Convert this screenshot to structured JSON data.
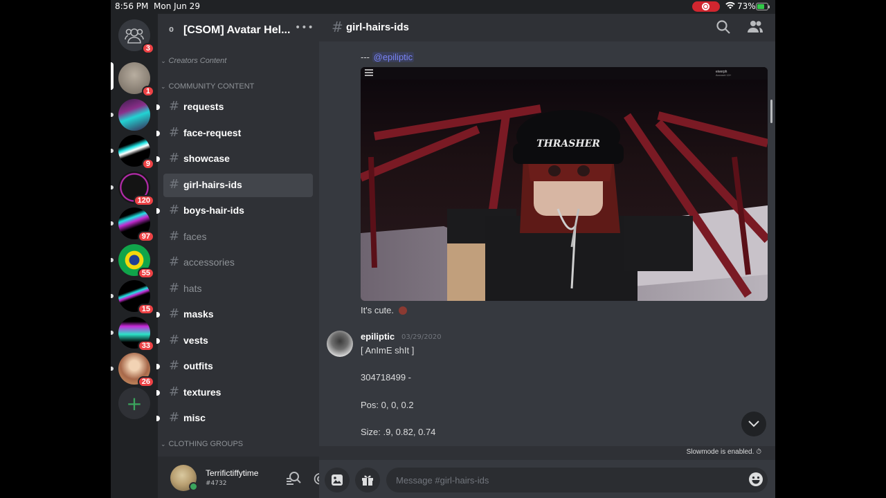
{
  "status_bar": {
    "time": "8:56 PM",
    "date": "Mon Jun 29",
    "battery_percent": "73%",
    "battery_level": 0.73,
    "recording": true,
    "colors": {
      "record": "#d0262f",
      "battery": "#33c84a"
    }
  },
  "servers": {
    "dm_badge": "3",
    "items": [
      {
        "name": "server-1",
        "badge": "1",
        "selected": true
      },
      {
        "name": "server-2",
        "badge": ""
      },
      {
        "name": "server-3",
        "badge": "9"
      },
      {
        "name": "server-4",
        "badge": "120"
      },
      {
        "name": "server-5",
        "badge": "97"
      },
      {
        "name": "server-6",
        "badge": "55"
      },
      {
        "name": "server-7",
        "badge": "15"
      },
      {
        "name": "server-8",
        "badge": "33"
      },
      {
        "name": "server-9",
        "badge": "26"
      }
    ],
    "add_label": "+"
  },
  "server_header": {
    "boost_count": "0",
    "name": "[CSOM] Avatar Hel...",
    "more_label": "•••"
  },
  "categories": {
    "creators": "Creators Content",
    "community": "COMMUNITY CONTENT",
    "clothing": "CLOTHING GROUPS"
  },
  "channels": [
    {
      "name": "requests",
      "state": "unread"
    },
    {
      "name": "face-request",
      "state": "unread"
    },
    {
      "name": "showcase",
      "state": "unread"
    },
    {
      "name": "girl-hairs-ids",
      "state": "active"
    },
    {
      "name": "boys-hair-ids",
      "state": "unread"
    },
    {
      "name": "faces",
      "state": "read"
    },
    {
      "name": "accessories",
      "state": "read"
    },
    {
      "name": "hats",
      "state": "read"
    },
    {
      "name": "masks",
      "state": "unread"
    },
    {
      "name": "vests",
      "state": "unread"
    },
    {
      "name": "outfits",
      "state": "unread"
    },
    {
      "name": "textures",
      "state": "unread"
    },
    {
      "name": "misc",
      "state": "unread"
    }
  ],
  "user": {
    "name": "Terrifictiffytime",
    "discriminator": "#4732",
    "status": "online"
  },
  "chat": {
    "channel_title": "girl-hairs-ids",
    "messages": {
      "prefix": "---",
      "mention": "@epiliptic",
      "embed_overlay_name": "eiverph",
      "embed_overlay_sub": "Account 13+",
      "embed_brand_text": "THRASHER",
      "caption": "It's cute.",
      "author": "epiliptic",
      "timestamp": "03/29/2020",
      "lines": [
        "[ AnImE shIt ]",
        "304718499 -",
        "Pos: 0, 0, 0.2",
        "Size: .9, 0.82, 0.74"
      ]
    },
    "slowmode_text": "Slowmode is enabled.",
    "input_placeholder": "Message #girl-hairs-ids"
  },
  "theme": {
    "mention_color": "#7983f5",
    "badge_color": "#ed4245",
    "online_color": "#3ba55d"
  }
}
